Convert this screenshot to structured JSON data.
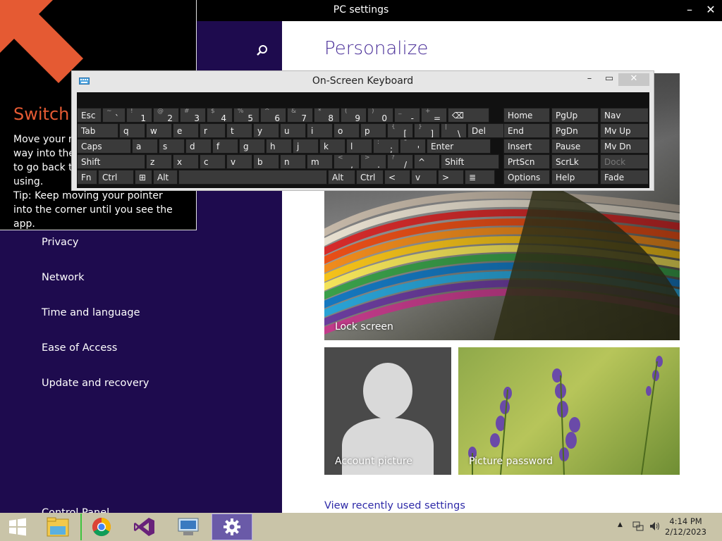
{
  "window": {
    "title": "PC settings",
    "minimize": "–",
    "close": "✕"
  },
  "left_nav": {
    "items": [
      "Privacy",
      "Network",
      "Time and language",
      "Ease of Access",
      "Update and recovery"
    ],
    "control_panel": "Control Panel"
  },
  "switch_panel": {
    "title": "Switch",
    "line1": "Move your mouse pointer all the",
    "line2": "way into the upper-left corner",
    "line3": "to go back to the app you were",
    "line4": "using.",
    "tip": "Tip: Keep moving your pointer into the corner until you see the app."
  },
  "right": {
    "title": "Personalize",
    "lock_screen": "Lock screen",
    "account_picture": "Account picture",
    "picture_password": "Picture password",
    "link": "View recently used settings"
  },
  "osk": {
    "title": "On-Screen Keyboard",
    "row1": [
      {
        "l": "Esc"
      },
      {
        "s": "~",
        "l": "`"
      },
      {
        "s": "!",
        "l": "1"
      },
      {
        "s": "@",
        "l": "2"
      },
      {
        "s": "#",
        "l": "3"
      },
      {
        "s": "$",
        "l": "4"
      },
      {
        "s": "%",
        "l": "5"
      },
      {
        "s": "^",
        "l": "6"
      },
      {
        "s": "&",
        "l": "7"
      },
      {
        "s": "*",
        "l": "8"
      },
      {
        "s": "(",
        "l": "9"
      },
      {
        "s": ")",
        "l": "0"
      },
      {
        "s": "_",
        "l": "-"
      },
      {
        "s": "+",
        "l": "="
      },
      {
        "l": "⌫"
      }
    ],
    "row2": [
      {
        "l": "Tab"
      },
      {
        "l": "q"
      },
      {
        "l": "w"
      },
      {
        "l": "e"
      },
      {
        "l": "r"
      },
      {
        "l": "t"
      },
      {
        "l": "y"
      },
      {
        "l": "u"
      },
      {
        "l": "i"
      },
      {
        "l": "o"
      },
      {
        "l": "p"
      },
      {
        "s": "{",
        "l": "["
      },
      {
        "s": "}",
        "l": "]"
      },
      {
        "s": "|",
        "l": "\\"
      },
      {
        "l": "Del"
      }
    ],
    "row3": [
      {
        "l": "Caps"
      },
      {
        "l": "a"
      },
      {
        "l": "s"
      },
      {
        "l": "d"
      },
      {
        "l": "f"
      },
      {
        "l": "g"
      },
      {
        "l": "h"
      },
      {
        "l": "j"
      },
      {
        "l": "k"
      },
      {
        "l": "l"
      },
      {
        "s": ":",
        "l": ";"
      },
      {
        "s": "\"",
        "l": "'"
      },
      {
        "l": "Enter"
      }
    ],
    "row4": [
      {
        "l": "Shift"
      },
      {
        "l": "z"
      },
      {
        "l": "x"
      },
      {
        "l": "c"
      },
      {
        "l": "v"
      },
      {
        "l": "b"
      },
      {
        "l": "n"
      },
      {
        "l": "m"
      },
      {
        "s": "<",
        "l": ","
      },
      {
        "s": ">",
        "l": "."
      },
      {
        "s": "?",
        "l": "/"
      },
      {
        "l": "^"
      },
      {
        "l": "Shift"
      }
    ],
    "row5": [
      {
        "l": "Fn"
      },
      {
        "l": "Ctrl"
      },
      {
        "l": "⊞"
      },
      {
        "l": "Alt"
      },
      {
        "l": ""
      },
      {
        "l": "Alt"
      },
      {
        "l": "Ctrl"
      },
      {
        "l": "<"
      },
      {
        "l": "v"
      },
      {
        "l": ">"
      },
      {
        "l": "≣"
      }
    ],
    "nav": [
      [
        "Home",
        "PgUp",
        "Nav"
      ],
      [
        "End",
        "PgDn",
        "Mv Up"
      ],
      [
        "Insert",
        "Pause",
        "Mv Dn"
      ],
      [
        "PrtScn",
        "ScrLk",
        "Dock"
      ],
      [
        "Options",
        "Help",
        "Fade"
      ]
    ]
  },
  "taskbar": {
    "time": "4:14 PM",
    "date": "2/12/2023",
    "apps": [
      "start-icon",
      "file-explorer-icon",
      "chrome-icon",
      "visual-studio-icon",
      "remote-desktop-icon",
      "settings-icon"
    ]
  }
}
